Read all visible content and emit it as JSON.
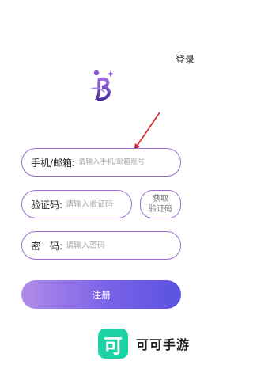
{
  "header": {
    "login_label": "登录"
  },
  "logo": {
    "name": "brand-logo",
    "colors": [
      "#8a5ad6",
      "#4b2fa8"
    ]
  },
  "form": {
    "account": {
      "label": "手机/邮箱:",
      "placeholder": "请输入手机/邮箱账号"
    },
    "code": {
      "label": "验证码:",
      "placeholder": "请输入验证码",
      "button_line1": "获取",
      "button_line2": "验证码"
    },
    "password": {
      "label": "密　码:",
      "placeholder": "请输入密码"
    },
    "submit_label": "注册"
  },
  "watermark": {
    "icon_text": "可",
    "text": "可可手游"
  },
  "colors": {
    "accent": "#9b6fd6",
    "arrow": "#d9262c",
    "watermark": "#1dd3a5"
  }
}
